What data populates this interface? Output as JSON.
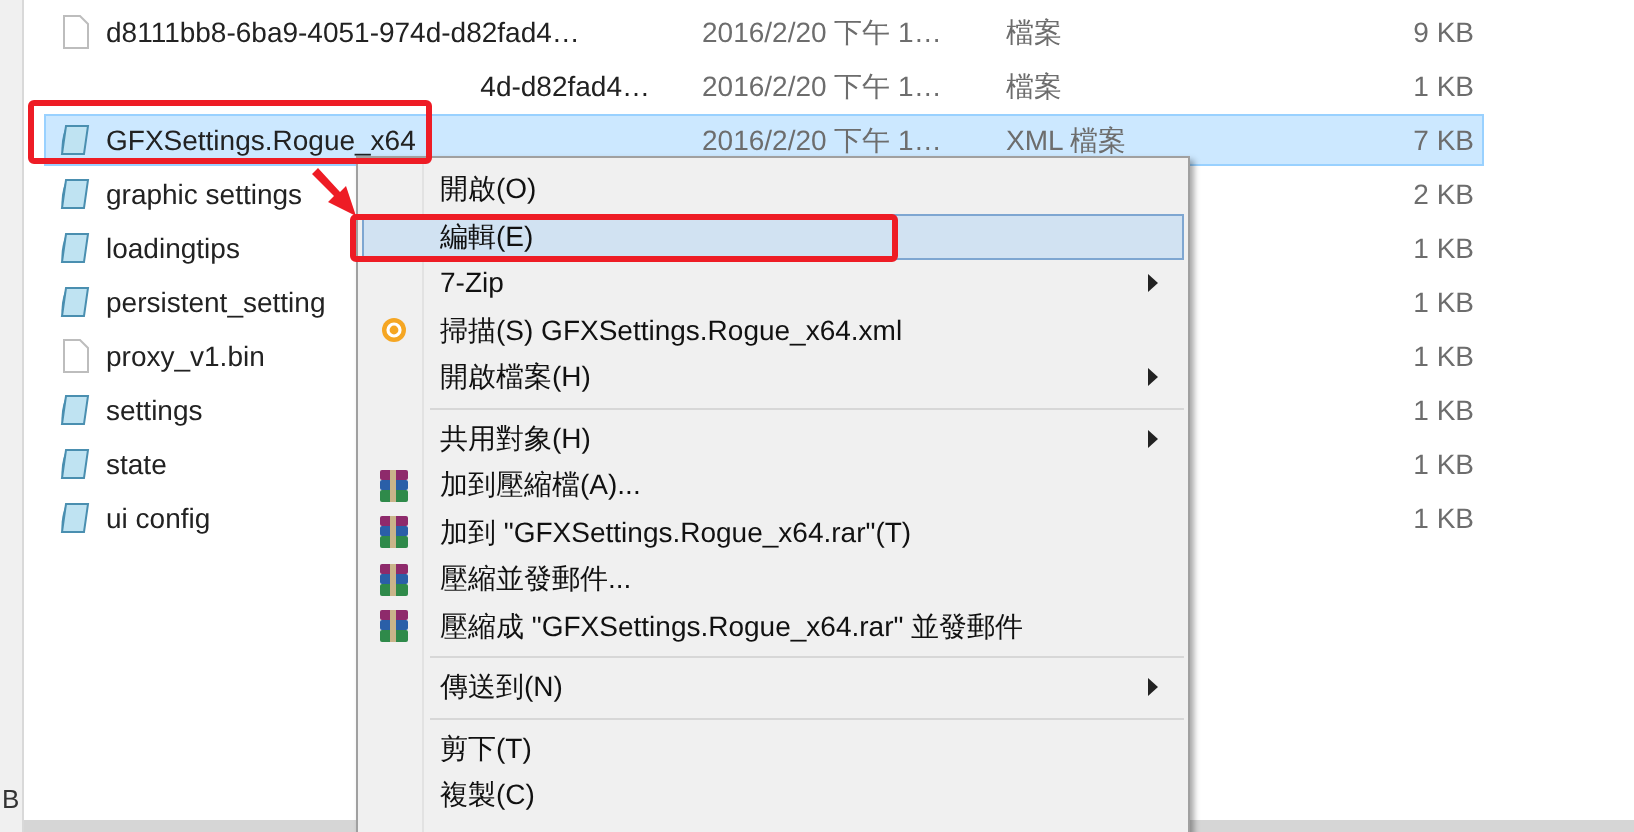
{
  "sidebar": {
    "text": "B"
  },
  "files": [
    {
      "kind": "blank",
      "name": "d8111bb8-6ba9-4051-974d-d82fad4…",
      "date": "2016/2/20 下午 1…",
      "type": "檔案",
      "size": "9 KB",
      "selected": false
    },
    {
      "kind": "partial",
      "name": "4d-d82fad4…",
      "date": "2016/2/20 下午 1…",
      "type": "檔案",
      "size": "1 KB",
      "selected": false
    },
    {
      "kind": "xml",
      "name": "GFXSettings.Rogue_x64",
      "date": "2016/2/20 下午 1…",
      "type": "XML 檔案",
      "size": "7 KB",
      "selected": true
    },
    {
      "kind": "xml",
      "name": "graphic settings",
      "size": "2 KB",
      "selected": false
    },
    {
      "kind": "xml",
      "name": "loadingtips",
      "size": "1 KB",
      "selected": false
    },
    {
      "kind": "xml",
      "name": "persistent_setting",
      "size": "1 KB",
      "selected": false
    },
    {
      "kind": "blank",
      "name": "proxy_v1.bin",
      "size": "1 KB",
      "selected": false
    },
    {
      "kind": "xml",
      "name": "settings",
      "size": "1 KB",
      "selected": false
    },
    {
      "kind": "xml",
      "name": "state",
      "size": "1 KB",
      "selected": false
    },
    {
      "kind": "xml",
      "name": "ui config",
      "size": "1 KB",
      "selected": false
    }
  ],
  "context_menu": [
    {
      "kind": "item",
      "label": "開啟(O)",
      "selected": false
    },
    {
      "kind": "item",
      "label": "編輯(E)",
      "selected": true
    },
    {
      "kind": "item",
      "label": "7-Zip",
      "submenu": true,
      "selected": false
    },
    {
      "kind": "scan",
      "label": "掃描(S) GFXSettings.Rogue_x64.xml",
      "selected": false
    },
    {
      "kind": "item",
      "label": "開啟檔案(H)",
      "submenu": true,
      "selected": false
    },
    {
      "kind": "separator"
    },
    {
      "kind": "item",
      "label": "共用對象(H)",
      "submenu": true,
      "selected": false
    },
    {
      "kind": "archive",
      "label": "加到壓縮檔(A)...",
      "selected": false
    },
    {
      "kind": "archive",
      "label": "加到 \"GFXSettings.Rogue_x64.rar\"(T)",
      "selected": false
    },
    {
      "kind": "archive",
      "label": "壓縮並發郵件...",
      "selected": false
    },
    {
      "kind": "archive",
      "label": "壓縮成 \"GFXSettings.Rogue_x64.rar\" 並發郵件",
      "selected": false
    },
    {
      "kind": "separator"
    },
    {
      "kind": "item",
      "label": "傳送到(N)",
      "submenu": true,
      "selected": false
    },
    {
      "kind": "separator"
    },
    {
      "kind": "item",
      "label": "剪下(T)",
      "selected": false
    },
    {
      "kind": "item",
      "label": "複製(C)",
      "selected": false
    }
  ]
}
